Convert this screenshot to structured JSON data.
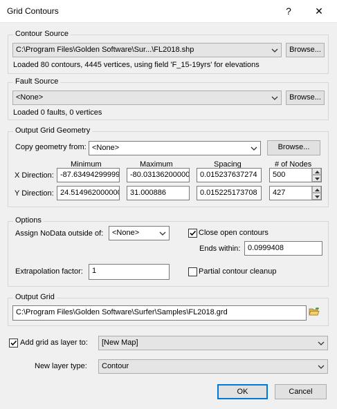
{
  "window": {
    "title": "Grid Contours",
    "help_glyph": "?",
    "close_glyph": "✕"
  },
  "contour_source": {
    "legend": "Contour Source",
    "file": "C:\\Program Files\\Golden Software\\Sur...\\FL2018.shp",
    "browse_label": "Browse...",
    "info": "Loaded 80 contours, 4445 vertices, using field 'F_15-19yrs' for elevations"
  },
  "fault_source": {
    "legend": "Fault Source",
    "value": "<None>",
    "browse_label": "Browse...",
    "info": "Loaded 0 faults, 0 vertices"
  },
  "output_geometry": {
    "legend": "Output Grid Geometry",
    "copy_label": "Copy geometry from:",
    "copy_value": "<None>",
    "browse_label": "Browse...",
    "headers": {
      "minimum": "Minimum",
      "maximum": "Maximum",
      "spacing": "Spacing",
      "nodes": "# of Nodes"
    },
    "x": {
      "label": "X Direction:",
      "min": "-87.63494299999",
      "max": "-80.031362000000",
      "spacing": "0.015237637274",
      "nodes": "500"
    },
    "y": {
      "label": "Y Direction:",
      "min": "24.514962000000",
      "max": "31.000886",
      "spacing": "0.015225173708",
      "nodes": "427"
    }
  },
  "options": {
    "legend": "Options",
    "nodata_label": "Assign NoData outside of:",
    "nodata_value": "<None>",
    "close_contours_label": "Close open contours",
    "close_contours_checked": true,
    "ends_within_label": "Ends within:",
    "ends_within_value": "0.0999408",
    "extrapolation_label": "Extrapolation factor:",
    "extrapolation_value": "1",
    "partial_cleanup_label": "Partial contour cleanup",
    "partial_cleanup_checked": false
  },
  "output_grid": {
    "legend": "Output Grid",
    "path": "C:\\Program Files\\Golden Software\\Surfer\\Samples\\FL2018.grd",
    "folder_icon": "open-folder-icon"
  },
  "add_layer": {
    "label": "Add grid as layer to:",
    "checked": true,
    "value": "[New Map]"
  },
  "layer_type": {
    "label": "New layer type:",
    "value": "Contour"
  },
  "buttons": {
    "ok": "OK",
    "cancel": "Cancel"
  }
}
